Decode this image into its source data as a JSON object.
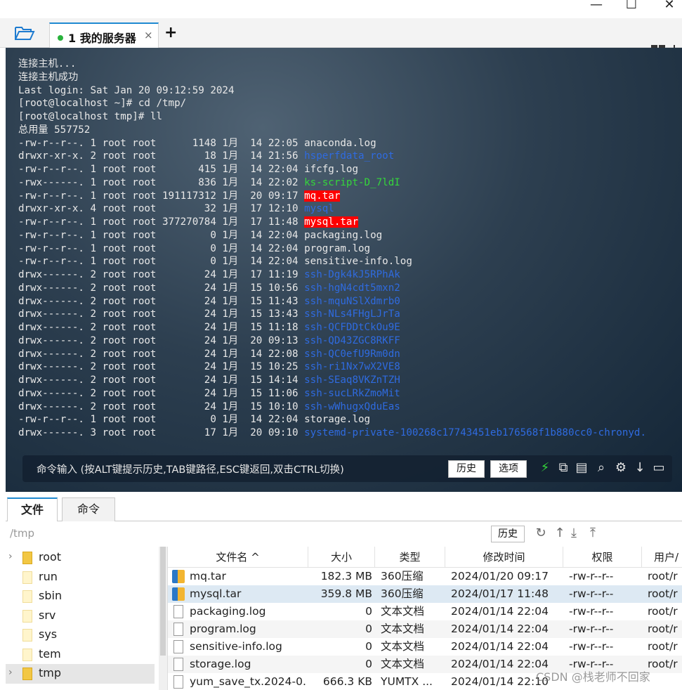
{
  "window": {
    "minimize": "—",
    "maximize": "☐",
    "close": "✕"
  },
  "tabs": [
    {
      "label": "1 我的服务器",
      "close": "×"
    }
  ],
  "add_tab": "+",
  "terminal": {
    "lines": [
      [
        {
          "t": "连接主机..."
        }
      ],
      [
        {
          "t": "连接主机成功"
        }
      ],
      [
        {
          "t": "Last login: Sat Jan 20 09:12:59 2024"
        }
      ],
      [
        {
          "t": "[root@localhost ~]# cd /tmp/"
        }
      ],
      [
        {
          "t": "[root@localhost tmp]# ll"
        }
      ],
      [
        {
          "t": "总用量 557752"
        }
      ],
      [
        {
          "t": "-rw-r--r--. 1 root root      1148 1月  14 22:05 "
        },
        {
          "t": "anaconda.log"
        }
      ],
      [
        {
          "t": "drwxr-xr-x. 2 root root        18 1月  14 21:56 "
        },
        {
          "t": "hsperfdata_root",
          "c": "blue"
        }
      ],
      [
        {
          "t": "-rw-r--r--. 1 root root       415 1月  14 22:04 "
        },
        {
          "t": "ifcfg.log"
        }
      ],
      [
        {
          "t": "-rwx------. 1 root root       836 1月  14 22:02 "
        },
        {
          "t": "ks-script-D_7ldI",
          "c": "green"
        }
      ],
      [
        {
          "t": "-rw-r--r--. 1 root root 191117312 1月  20 09:17 "
        },
        {
          "t": "mq.tar",
          "c": "red"
        }
      ],
      [
        {
          "t": "drwxr-xr-x. 4 root root        32 1月  17 12:10 "
        },
        {
          "t": "mysql",
          "c": "blue"
        }
      ],
      [
        {
          "t": "-rw-r--r--. 1 root root 377270784 1月  17 11:48 "
        },
        {
          "t": "mysql.tar",
          "c": "red"
        }
      ],
      [
        {
          "t": "-rw-r--r--. 1 root root         0 1月  14 22:04 "
        },
        {
          "t": "packaging.log"
        }
      ],
      [
        {
          "t": "-rw-r--r--. 1 root root         0 1月  14 22:04 "
        },
        {
          "t": "program.log"
        }
      ],
      [
        {
          "t": "-rw-r--r--. 1 root root         0 1月  14 22:04 "
        },
        {
          "t": "sensitive-info.log"
        }
      ],
      [
        {
          "t": "drwx------. 2 root root        24 1月  17 11:19 "
        },
        {
          "t": "ssh-Dgk4kJ5RPhAk",
          "c": "blue"
        }
      ],
      [
        {
          "t": "drwx------. 2 root root        24 1月  15 10:56 "
        },
        {
          "t": "ssh-hgN4cdt5mxn2",
          "c": "blue"
        }
      ],
      [
        {
          "t": "drwx------. 2 root root        24 1月  15 11:43 "
        },
        {
          "t": "ssh-mquNSlXdmrb0",
          "c": "blue"
        }
      ],
      [
        {
          "t": "drwx------. 2 root root        24 1月  15 13:43 "
        },
        {
          "t": "ssh-NLs4FHgLJrTa",
          "c": "blue"
        }
      ],
      [
        {
          "t": "drwx------. 2 root root        24 1月  15 11:18 "
        },
        {
          "t": "ssh-QCFDDtCkOu9E",
          "c": "blue"
        }
      ],
      [
        {
          "t": "drwx------. 2 root root        24 1月  20 09:13 "
        },
        {
          "t": "ssh-QD43ZGC8RKFF",
          "c": "blue"
        }
      ],
      [
        {
          "t": "drwx------. 2 root root        24 1月  14 22:08 "
        },
        {
          "t": "ssh-QC0efU9Rm0dn",
          "c": "blue"
        }
      ],
      [
        {
          "t": "drwx------. 2 root root        24 1月  15 10:25 "
        },
        {
          "t": "ssh-ri1Nx7wX2VE8",
          "c": "blue"
        }
      ],
      [
        {
          "t": "drwx------. 2 root root        24 1月  15 14:14 "
        },
        {
          "t": "ssh-SEaq8VKZnTZH",
          "c": "blue"
        }
      ],
      [
        {
          "t": "drwx------. 2 root root        24 1月  15 11:06 "
        },
        {
          "t": "ssh-sucLRkZmoMit",
          "c": "blue"
        }
      ],
      [
        {
          "t": "drwx------. 2 root root        24 1月  15 10:10 "
        },
        {
          "t": "ssh-wWhugxQduEas",
          "c": "blue"
        }
      ],
      [
        {
          "t": "-rw-r--r--. 1 root root         0 1月  14 22:04 "
        },
        {
          "t": "storage.log"
        }
      ],
      [
        {
          "t": "drwx------. 3 root root        17 1月  20 09:10 "
        },
        {
          "t": "systemd-private-100268c17743451eb176568f1b880cc0-chronyd.",
          "c": "blue"
        }
      ]
    ],
    "highlight_color": "#ff0000",
    "blue_color": "#2f6be0",
    "green_color": "#35d63b"
  },
  "command_bar": {
    "placeholder": "命令输入 (按ALT键提示历史,TAB键路径,ESC键返回,双击CTRL切换)",
    "history_label": "历史",
    "options_label": "选项",
    "icons": [
      "lightning-icon",
      "copy-icon",
      "paste-icon",
      "search-icon",
      "gear-icon",
      "download-icon",
      "fullscreen-icon"
    ]
  },
  "bottom_tabs": [
    {
      "label": "文件"
    },
    {
      "label": "命令"
    }
  ],
  "path_bar": {
    "path": "/tmp",
    "history_label": "历史"
  },
  "tree": [
    {
      "name": "root",
      "arrow": true
    },
    {
      "name": "run"
    },
    {
      "name": "sbin"
    },
    {
      "name": "srv"
    },
    {
      "name": "sys"
    },
    {
      "name": "tem"
    },
    {
      "name": "tmp",
      "arrow": true,
      "selected": true
    }
  ],
  "file_table": {
    "columns": [
      "文件名 ^",
      "大小",
      "类型",
      "修改时间",
      "权限",
      "用户/"
    ],
    "rows": [
      {
        "name": "mq.tar",
        "size": "182.3 MB",
        "type": "360压缩",
        "mtime": "2024/01/20 09:17",
        "perm": "-rw-r--r--",
        "user": "root/r",
        "icon": "archive"
      },
      {
        "name": "mysql.tar",
        "size": "359.8 MB",
        "type": "360压缩",
        "mtime": "2024/01/17 11:48",
        "perm": "-rw-r--r--",
        "user": "root/r",
        "icon": "archive",
        "selected": true
      },
      {
        "name": "packaging.log",
        "size": "0",
        "type": "文本文档",
        "mtime": "2024/01/14 22:04",
        "perm": "-rw-r--r--",
        "user": "root/r",
        "icon": "doc"
      },
      {
        "name": "program.log",
        "size": "0",
        "type": "文本文档",
        "mtime": "2024/01/14 22:04",
        "perm": "-rw-r--r--",
        "user": "root/r",
        "icon": "doc"
      },
      {
        "name": "sensitive-info.log",
        "size": "0",
        "type": "文本文档",
        "mtime": "2024/01/14 22:04",
        "perm": "-rw-r--r--",
        "user": "root/r",
        "icon": "doc"
      },
      {
        "name": "storage.log",
        "size": "0",
        "type": "文本文档",
        "mtime": "2024/01/14 22:04",
        "perm": "-rw-r--r--",
        "user": "root/r",
        "icon": "doc"
      },
      {
        "name": "yum_save_tx.2024-0...",
        "size": "666.3 KB",
        "type": "YUMTX ...",
        "mtime": "2024/01/14 22:10",
        "perm": "",
        "user": "",
        "icon": "doc"
      }
    ]
  },
  "watermark": "CSDN @栈老师不回家"
}
